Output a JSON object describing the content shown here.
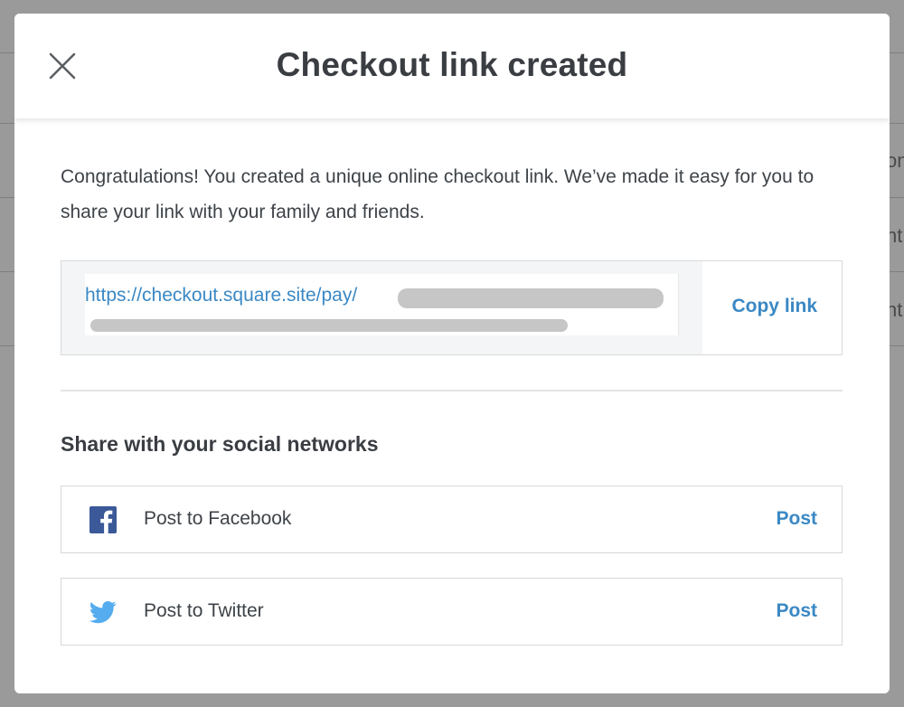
{
  "background": {
    "fragments": [
      "on",
      "nt",
      "nt"
    ]
  },
  "modal": {
    "title": "Checkout link created",
    "close_icon": "close-icon",
    "intro": "Congratulations! You created a unique online checkout link. We’ve made it easy for you to share your link with your family and friends.",
    "link": {
      "url_visible": "https://checkout.square.site/pay/",
      "copy_label": "Copy link"
    },
    "share": {
      "heading": "Share with your social networks",
      "items": [
        {
          "icon": "facebook-icon",
          "label": "Post to Facebook",
          "action": "Post"
        },
        {
          "icon": "twitter-icon",
          "label": "Post to Twitter",
          "action": "Post"
        }
      ]
    },
    "colors": {
      "accent": "#3a88c4",
      "title": "#3a3d42",
      "facebook": "#3b5998",
      "twitter": "#55acee"
    }
  }
}
